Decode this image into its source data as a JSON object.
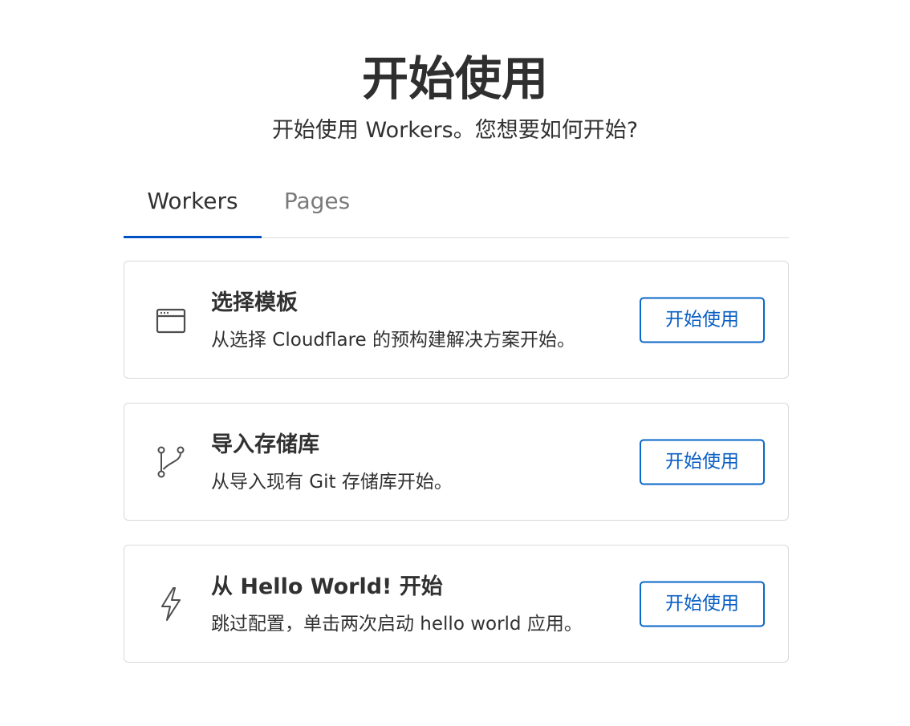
{
  "header": {
    "title": "开始使用",
    "subtitle": "开始使用 Workers。您想要如何开始?"
  },
  "tabs": [
    {
      "label": "Workers",
      "active": true
    },
    {
      "label": "Pages",
      "active": false
    }
  ],
  "accent_color": "#0051c3",
  "cards": [
    {
      "icon": "browser-window-icon",
      "title": "选择模板",
      "description": "从选择 Cloudflare 的预构建解决方案开始。",
      "button_label": "开始使用"
    },
    {
      "icon": "git-branch-icon",
      "title": "导入存储库",
      "description": "从导入现有 Git 存储库开始。",
      "button_label": "开始使用"
    },
    {
      "icon": "lightning-bolt-icon",
      "title": "从 Hello World! 开始",
      "description": "跳过配置，单击两次启动 hello world 应用。",
      "button_label": "开始使用"
    }
  ]
}
